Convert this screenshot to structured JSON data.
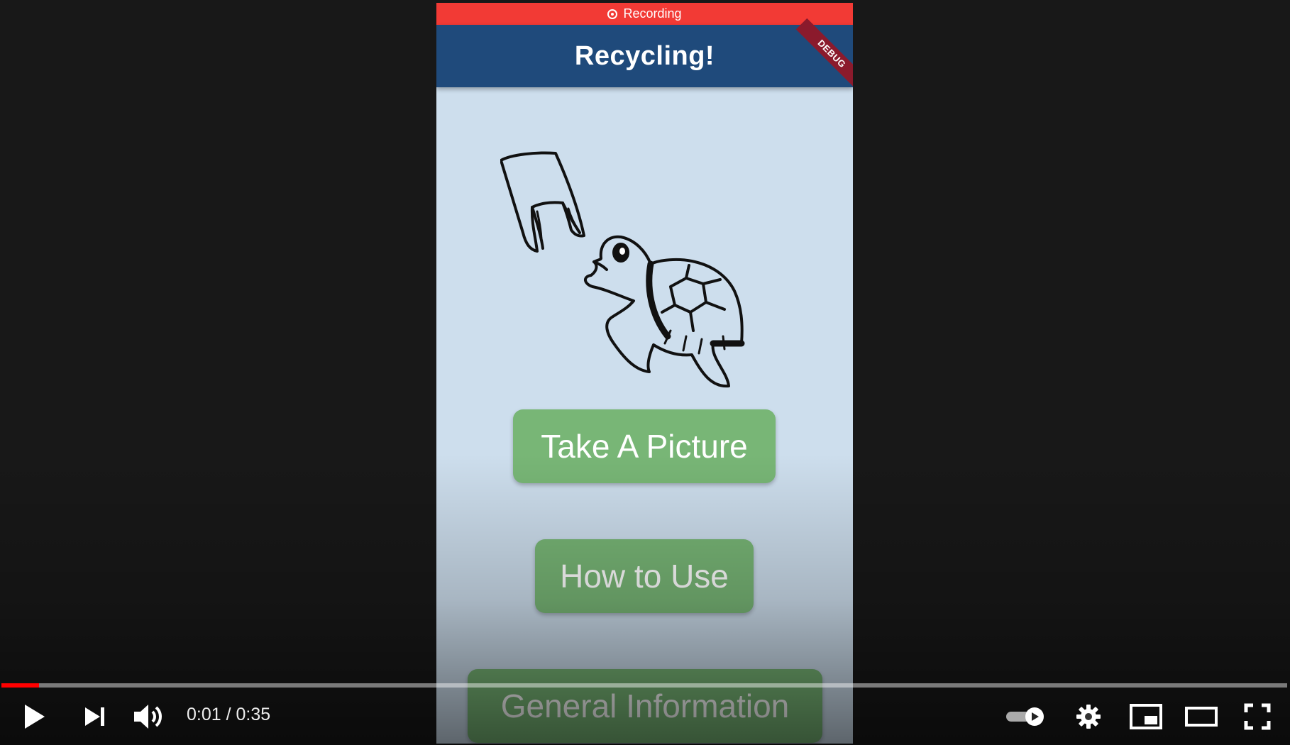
{
  "app": {
    "recording_label": "Recording",
    "title": "Recycling!",
    "debug_banner": "DEBUG"
  },
  "buttons": {
    "take_picture": "Take A Picture",
    "how_to_use": "How to Use",
    "general_information": "General Information"
  },
  "player": {
    "current_time": "0:01",
    "duration": "0:35",
    "time_display": "0:01 / 0:35",
    "progress_fraction": 0.029,
    "icons": [
      "play-icon",
      "next-icon",
      "volume-icon",
      "autoplay-toggle-icon",
      "settings-gear-icon",
      "miniplayer-icon",
      "theater-mode-icon",
      "fullscreen-icon"
    ]
  },
  "colors": {
    "recording_bar": "#f23a35",
    "app_bar": "#1f4a7b",
    "button": "#78b676",
    "screen_bg": "#cddeed",
    "progress": "#ff0000"
  }
}
